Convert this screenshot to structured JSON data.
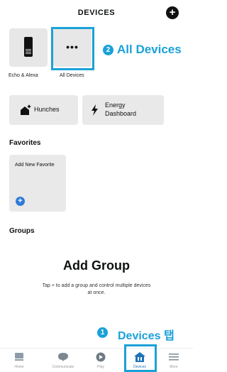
{
  "header": {
    "title": "DEVICES",
    "add_icon": "plus-circle-icon"
  },
  "devices": [
    {
      "label": "Echo & Alexa",
      "icon": "echo-device-icon"
    },
    {
      "label": "All Devices",
      "icon": "more-dots-icon"
    }
  ],
  "callouts": {
    "all_devices": {
      "number": "2",
      "text": "All Devices"
    },
    "devices_tab": {
      "number": "1",
      "text": "Devices 탭"
    }
  },
  "shortcuts": [
    {
      "label": "Hunches",
      "icon": "house-sparkle-icon"
    },
    {
      "label": "Energy Dashboard",
      "icon": "lightning-icon"
    }
  ],
  "favorites": {
    "title": "Favorites",
    "card_label": "Add New Favorite",
    "card_icon": "plus-icon"
  },
  "groups": {
    "title": "Groups",
    "empty_title": "Add Group",
    "empty_desc": "Tap + to add a group and control multiple devices at once."
  },
  "nav": [
    {
      "label": "Home",
      "icon": "home-icon"
    },
    {
      "label": "Communicate",
      "icon": "chat-bubble-icon"
    },
    {
      "label": "Play",
      "icon": "play-icon"
    },
    {
      "label": "Devices",
      "icon": "devices-icon",
      "active": true
    },
    {
      "label": "More",
      "icon": "menu-icon"
    }
  ],
  "colors": {
    "accent": "#1aa1d8",
    "active_nav": "#1f73b7"
  }
}
